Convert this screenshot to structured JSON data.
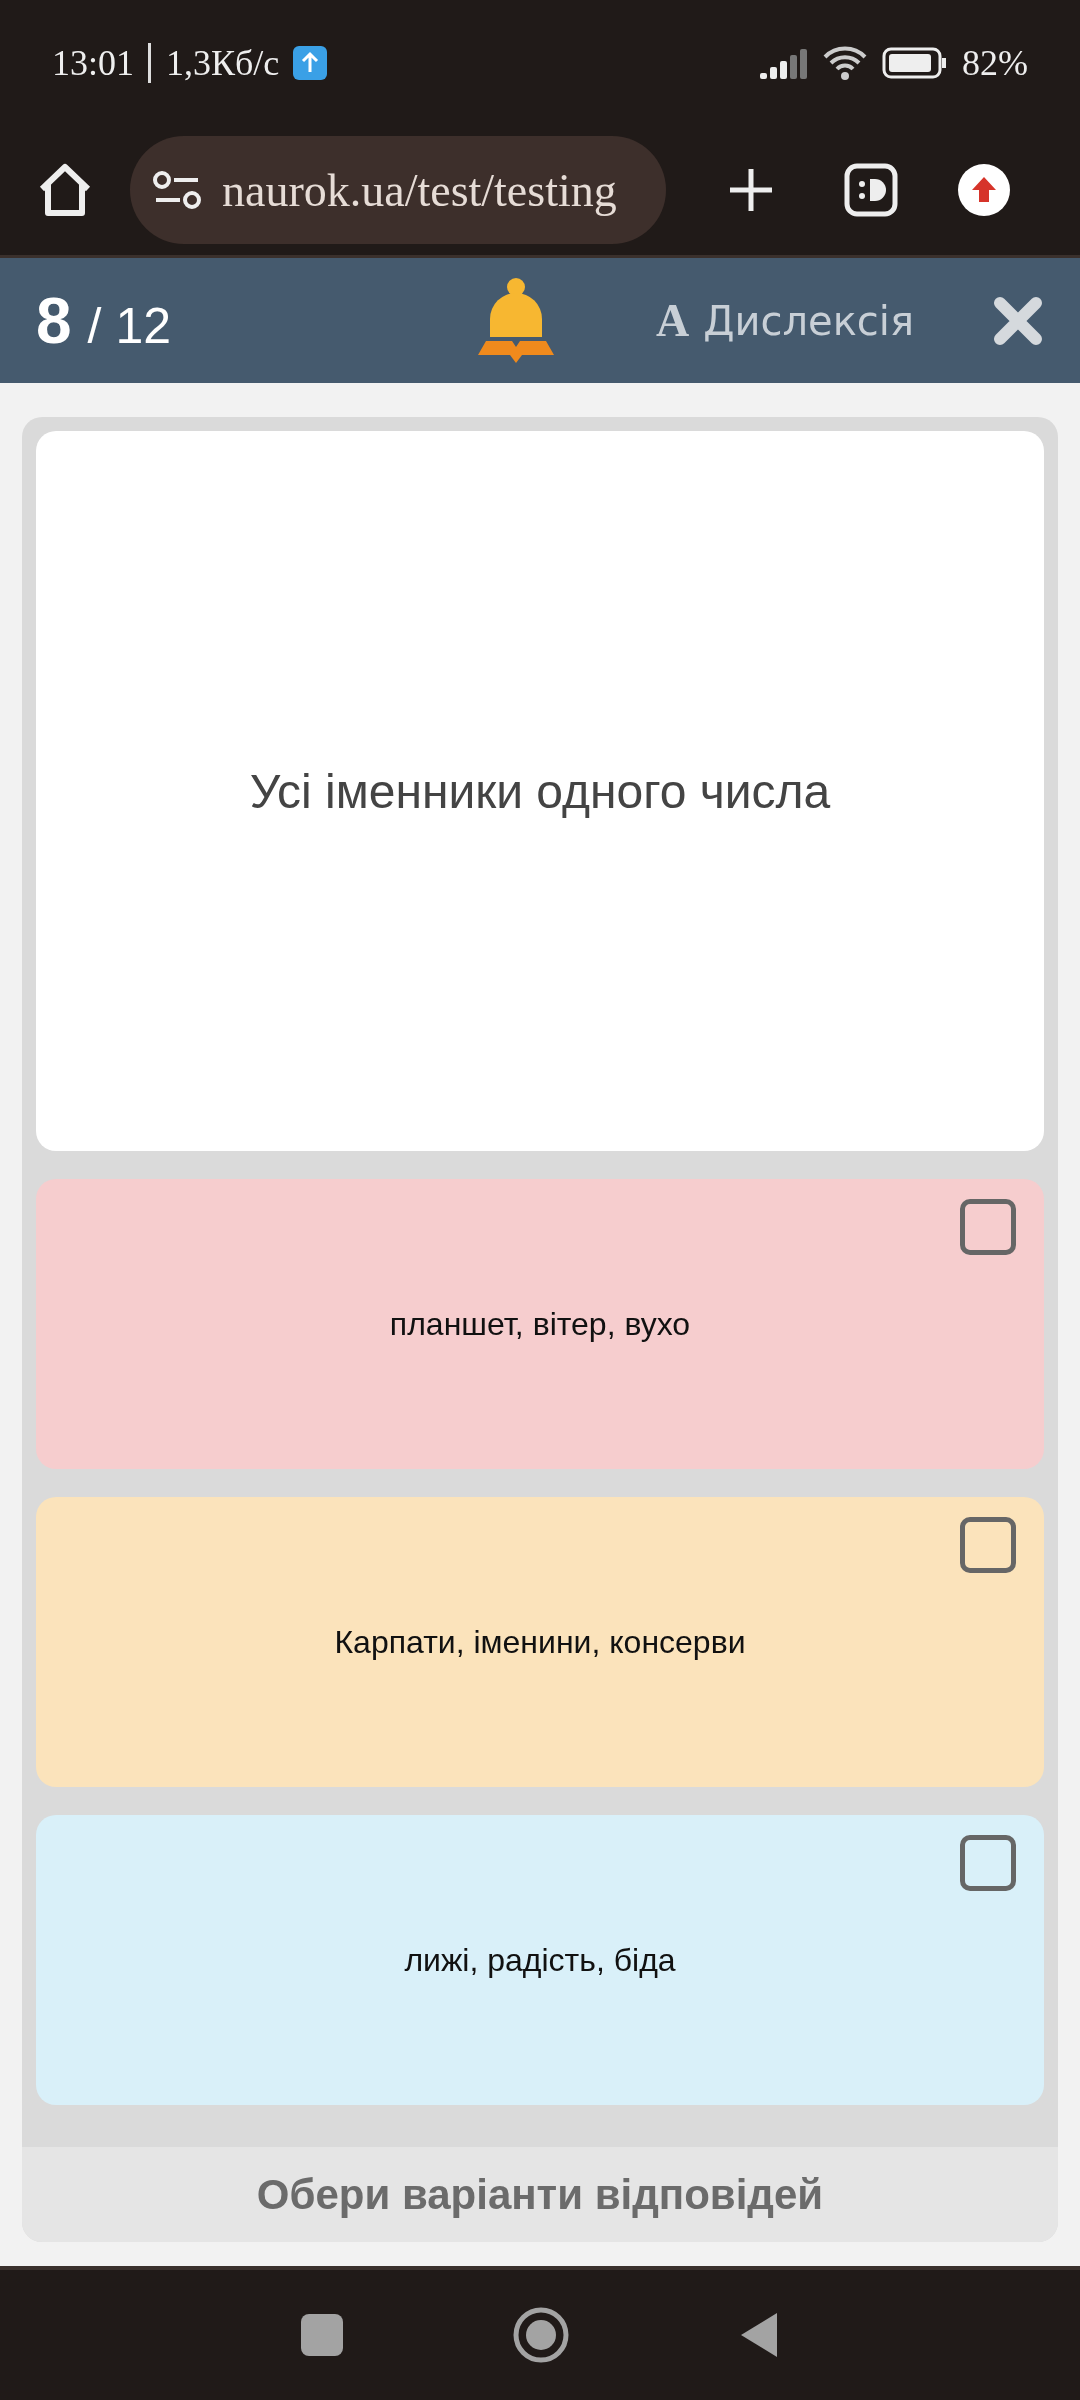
{
  "status_bar": {
    "time": "13:01",
    "speed": "1,3Кб/с",
    "battery": "82%"
  },
  "browser": {
    "url": "naurok.ua/test/testing"
  },
  "header": {
    "current": "8",
    "total": "/ 12",
    "dyslexia_glyph": "A",
    "dyslexia_label": "Дислексія"
  },
  "question": {
    "text": "Усі іменники одного числа"
  },
  "options": [
    {
      "text": "планшет, вітер, вухо",
      "color": "#f6cdce",
      "checked": false
    },
    {
      "text": "Карпати, іменини, консерви",
      "color": "#fbe3bb",
      "checked": false
    },
    {
      "text": "лижі, радість, біда",
      "color": "#d9f0f9",
      "checked": false
    }
  ],
  "footer": {
    "hint": "Обери варіанти відповідей"
  }
}
